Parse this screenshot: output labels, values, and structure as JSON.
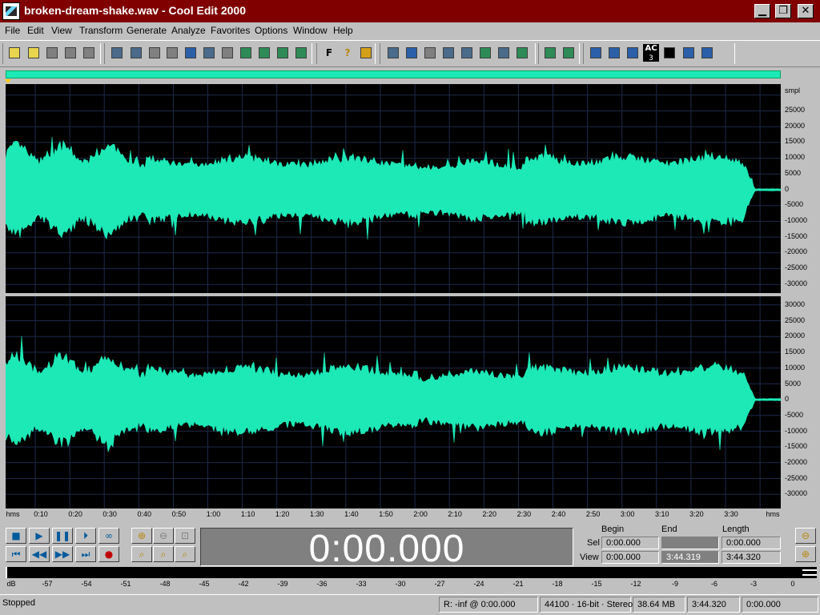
{
  "window": {
    "title": "broken-dream-shake.wav - Cool Edit 2000",
    "minimize": "▁",
    "maximize": "❐",
    "close": "✕"
  },
  "menu": [
    "File",
    "Edit",
    "View",
    "Transform",
    "Generate",
    "Analyze",
    "Favorites",
    "Options",
    "Window",
    "Help"
  ],
  "toolbar_icons": [
    "new-file-icon",
    "open-file-icon",
    "save-icon",
    "save-as-icon",
    "save-selection-icon",
    "undo-icon",
    "loop-play-icon",
    "edit-waveform-icon",
    "multitrack-icon",
    "copy-icon",
    "cut-icon",
    "paste-icon",
    "mix-paste-icon",
    "crop-icon",
    "insert-icon",
    "find-icon",
    "favorites-icon",
    "help-icon",
    "fx-icon",
    "amplify-icon",
    "envelope-icon",
    "normalize-icon",
    "stretch-icon",
    "noise-reduction-icon",
    "filter-icon",
    "spectrum-icon",
    "cd-player-icon",
    "batch-icon",
    "settings-icon",
    "mix-icon",
    "waves-icon",
    "grid-icon",
    "ac3-icon",
    "reverb-icon",
    "pitch-icon",
    "note-icon"
  ],
  "ac3_label": "AC",
  "ac3_sub": "3",
  "waveform_color": "#1de9b6",
  "amplitude_ruler": {
    "unit_label": "smpl",
    "top_channel": [
      "25000",
      "20000",
      "15000",
      "10000",
      "5000",
      "0",
      "-5000",
      "-10000",
      "-15000",
      "-20000",
      "-25000",
      "-30000"
    ],
    "bottom_channel": [
      "30000",
      "25000",
      "20000",
      "15000",
      "10000",
      "5000",
      "0",
      "-5000",
      "-10000",
      "-15000",
      "-20000",
      "-25000",
      "-30000"
    ]
  },
  "time_ruler": {
    "left_unit": "hms",
    "right_unit": "hms",
    "ticks": [
      "0:10",
      "0:20",
      "0:30",
      "0:40",
      "0:50",
      "1:00",
      "1:10",
      "1:20",
      "1:30",
      "1:40",
      "1:50",
      "2:00",
      "2:10",
      "2:20",
      "2:30",
      "2:40",
      "2:50",
      "3:00",
      "3:10",
      "3:20",
      "3:30"
    ]
  },
  "transport": {
    "buttons": [
      "stop-button",
      "play-button",
      "pause-button",
      "play-to-end-button",
      "loop-button",
      "go-start-button",
      "rewind-button",
      "fast-forward-button",
      "go-end-button",
      "record-button"
    ],
    "zoom_buttons": [
      "zoom-in-horizontal-button",
      "zoom-out-horizontal-button",
      "zoom-full-button",
      "zoom-selection-button",
      "zoom-left-button",
      "zoom-right-button"
    ],
    "vertical_zoom": [
      "zoom-out-vertical-button",
      "zoom-in-vertical-button"
    ]
  },
  "time_display": "0:00.000",
  "selection": {
    "begin_header": "Begin",
    "end_header": "End",
    "length_header": "Length",
    "sel_label": "Sel",
    "view_label": "View",
    "sel_begin": "0:00.000",
    "sel_end": "",
    "sel_length": "0:00.000",
    "view_begin": "0:00.000",
    "view_end": "3:44.319",
    "view_length": "3:44.320"
  },
  "level_ruler": {
    "unit": "dB",
    "ticks": [
      "-57",
      "-54",
      "-51",
      "-48",
      "-45",
      "-42",
      "-39",
      "-36",
      "-33",
      "-30",
      "-27",
      "-24",
      "-21",
      "-18",
      "-15",
      "-12",
      "-9",
      "-6",
      "-3",
      "0"
    ]
  },
  "status": {
    "state": "Stopped",
    "cursor": "R: -inf @   0:00.000",
    "format": "44100 · 16-bit · Stereo",
    "size": "38.64 MB",
    "duration": "3:44.320",
    "position": "0:00.000"
  }
}
